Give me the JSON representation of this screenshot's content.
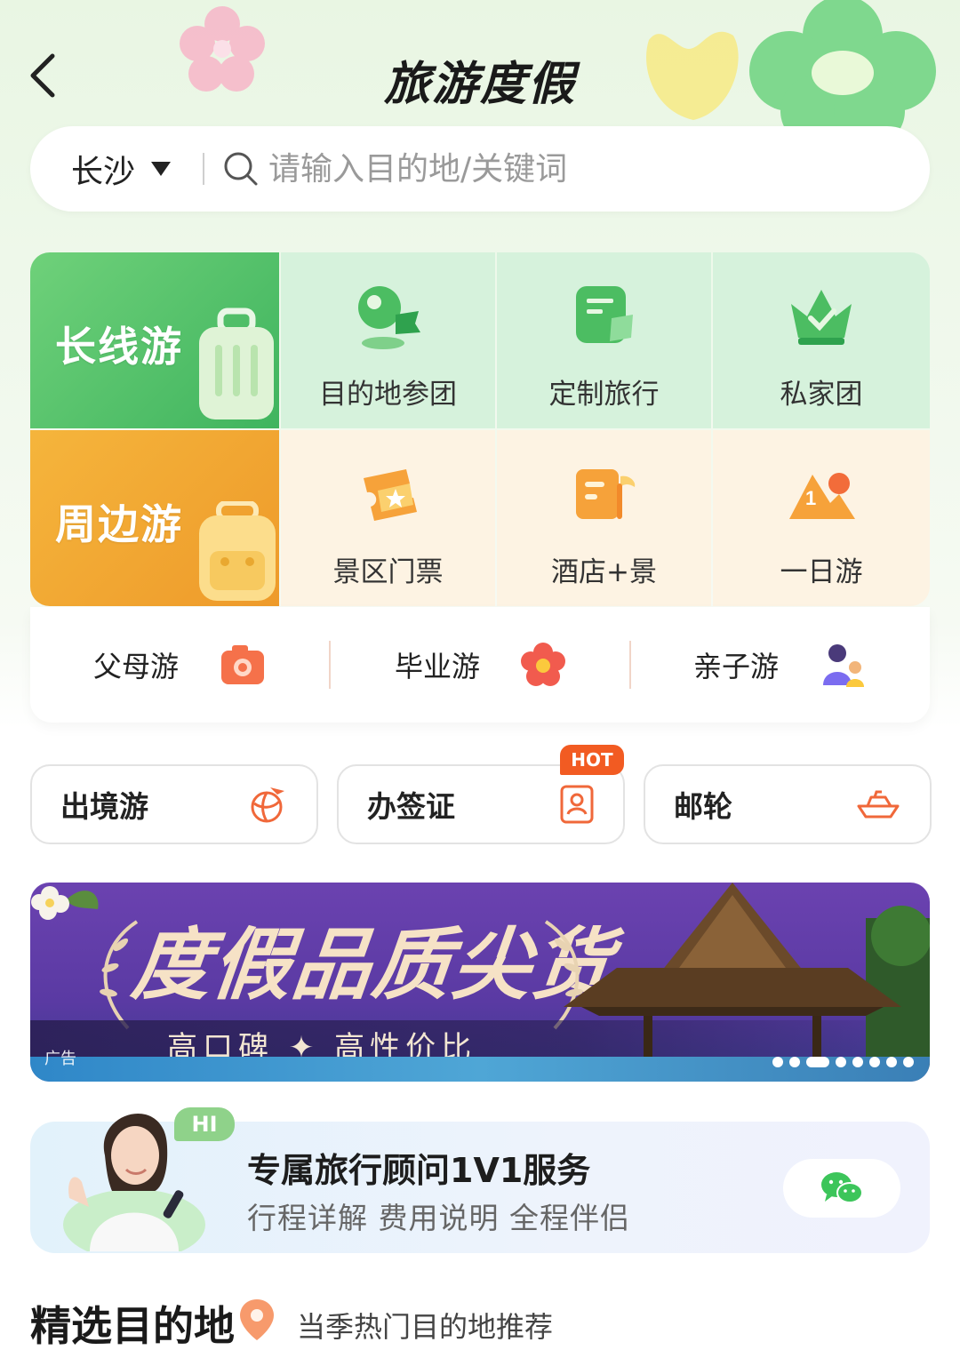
{
  "header": {
    "title": "旅游度假"
  },
  "search": {
    "city": "长沙",
    "placeholder": "请输入目的地/关键词"
  },
  "categories": {
    "long_trip": {
      "label": "长线游"
    },
    "nearby_trip": {
      "label": "周边游"
    },
    "row1": [
      {
        "label": "目的地参团",
        "icon": "destination-pin-flag-icon"
      },
      {
        "label": "定制旅行",
        "icon": "custom-travel-card-icon"
      },
      {
        "label": "私家团",
        "icon": "crown-check-icon"
      }
    ],
    "row2": [
      {
        "label": "景区门票",
        "icon": "ticket-star-icon"
      },
      {
        "label": "酒店+景",
        "icon": "hotel-palm-icon"
      },
      {
        "label": "一日游",
        "icon": "mountain-sun-icon"
      }
    ]
  },
  "themes": [
    {
      "label": "父母游",
      "icon": "camera-icon"
    },
    {
      "label": "毕业游",
      "icon": "flower-icon"
    },
    {
      "label": "亲子游",
      "icon": "parent-child-icon"
    }
  ],
  "services": [
    {
      "label": "出境游",
      "icon": "globe-plane-icon"
    },
    {
      "label": "办签证",
      "icon": "id-card-icon",
      "badge": "HOT"
    },
    {
      "label": "邮轮",
      "icon": "cruise-ship-icon"
    }
  ],
  "banner": {
    "headline": "度假品质尖货",
    "subline": "高口碑 ✦ 高性价比",
    "ad_label": "广告",
    "slide_count": 8,
    "active_slide": 3
  },
  "advisor": {
    "badge": "HI",
    "title": "专属旅行顾问1V1服务",
    "subtitle": "行程详解 费用说明 全程伴侣",
    "button_icon": "wechat-icon"
  },
  "section": {
    "title": "精选目的地",
    "subtitle": "当季热门目的地推荐"
  },
  "colors": {
    "green_tile": "#4fbf66",
    "orange_tile": "#f0a631",
    "hot_badge": "#f25b22",
    "banner_purple": "#5f3ea8"
  }
}
